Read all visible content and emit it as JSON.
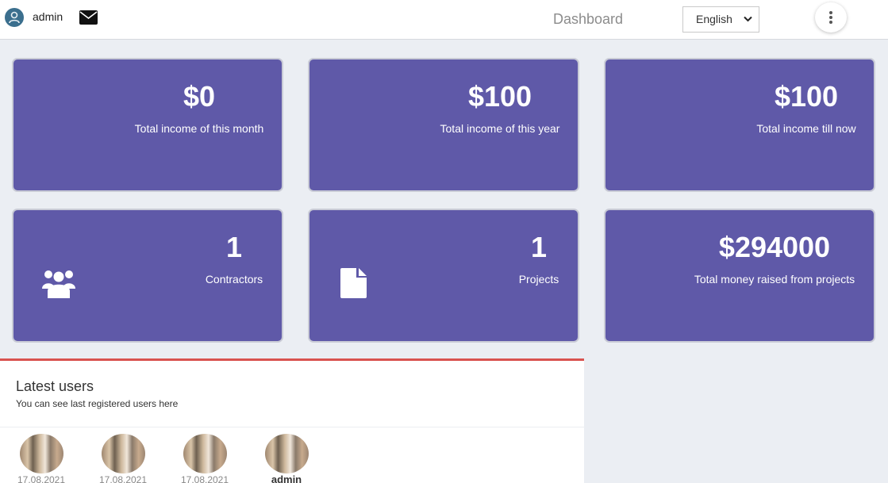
{
  "header": {
    "username": "admin",
    "page_title": "Dashboard",
    "language": "English",
    "icons": [
      "user-avatar",
      "envelope-icon",
      "chevron-down-icon",
      "kebab-menu-icon"
    ]
  },
  "cards": [
    {
      "value": "$0",
      "label": "Total income of this month"
    },
    {
      "value": "$100",
      "label": "Total income of this year"
    },
    {
      "value": "$100",
      "label": "Total income till now"
    },
    {
      "value": "1",
      "label": "Contractors",
      "icon": "users-icon"
    },
    {
      "value": "1",
      "label": "Projects",
      "icon": "file-icon"
    },
    {
      "value": "$294000",
      "label": "Total money raised from projects"
    }
  ],
  "latest_users": {
    "title": "Latest users",
    "subtitle": "You can see last registered users here",
    "users": [
      {
        "name": "17.08.2021"
      },
      {
        "name": "17.08.2021"
      },
      {
        "name": "17.08.2021"
      },
      {
        "name": "admin"
      }
    ]
  },
  "colors": {
    "card_bg": "#5f59a8",
    "panel_accent": "#d9534f",
    "page_bg": "#ebeef3"
  }
}
